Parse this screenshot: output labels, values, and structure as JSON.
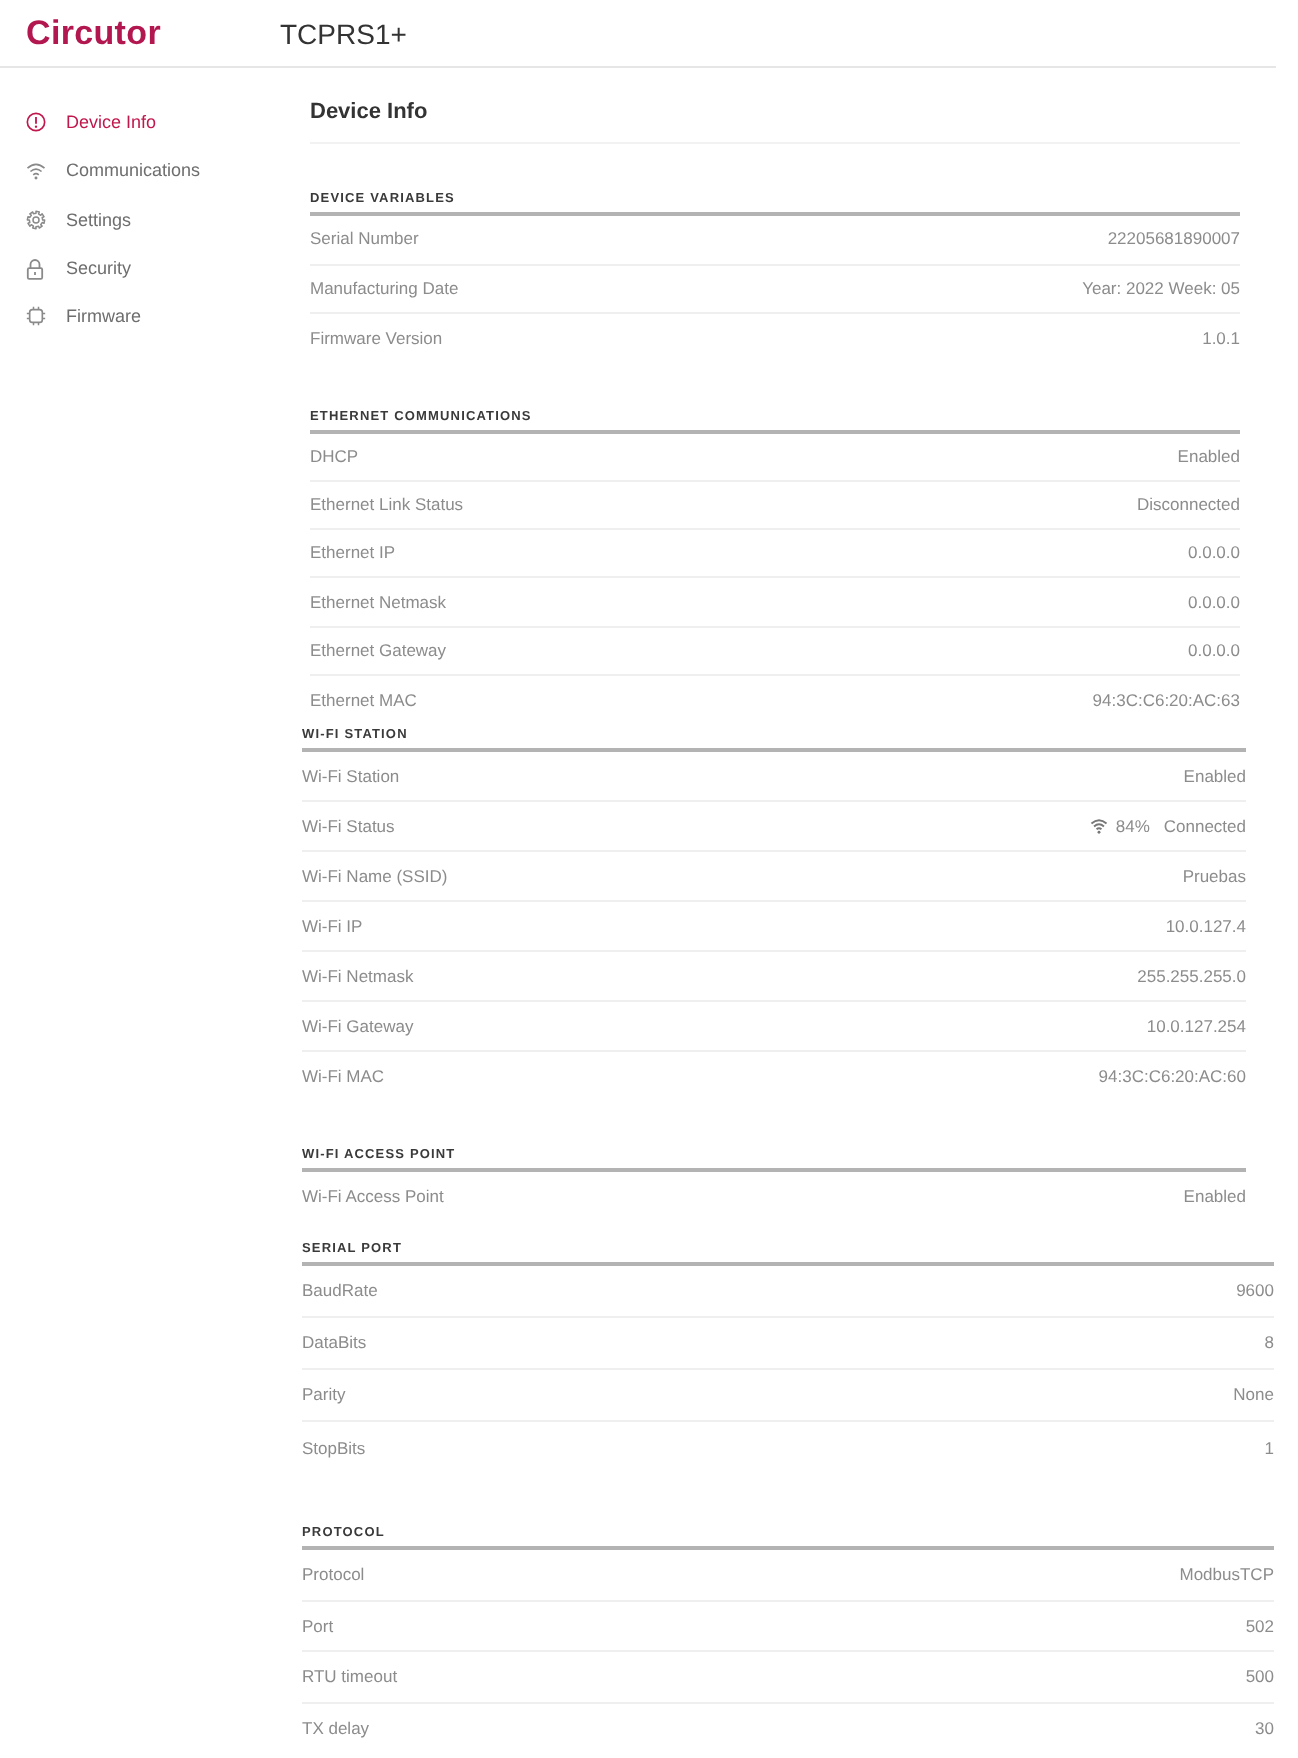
{
  "header": {
    "logo": "Circutor",
    "device": "TCPRS1+"
  },
  "sidebar": {
    "items": [
      {
        "label": "Device Info",
        "selected": true
      },
      {
        "label": "Communications",
        "selected": false
      },
      {
        "label": "Settings",
        "selected": false
      },
      {
        "label": "Security",
        "selected": false
      },
      {
        "label": "Firmware",
        "selected": false
      }
    ]
  },
  "page": {
    "title": "Device Info"
  },
  "sections": [
    {
      "title": "DEVICE VARIABLES",
      "rows": [
        {
          "kind": "text",
          "label": "Serial Number",
          "value": "22205681890007"
        },
        {
          "kind": "text",
          "label": "Manufacturing Date",
          "value": "Year: 2022 Week: 05"
        },
        {
          "kind": "text",
          "label": "Firmware Version",
          "value": "1.0.1"
        }
      ]
    },
    {
      "title": "ETHERNET COMMUNICATIONS",
      "rows": [
        {
          "kind": "text",
          "label": "DHCP",
          "value": "Enabled"
        },
        {
          "kind": "text",
          "label": "Ethernet Link Status",
          "value": "Disconnected"
        },
        {
          "kind": "text",
          "label": "Ethernet IP",
          "value": "0.0.0.0"
        },
        {
          "kind": "text",
          "label": "Ethernet Netmask",
          "value": "0.0.0.0"
        },
        {
          "kind": "text",
          "label": "Ethernet Gateway",
          "value": "0.0.0.0"
        },
        {
          "kind": "text",
          "label": "Ethernet MAC",
          "value": "94:3C:C6:20:AC:63"
        }
      ]
    },
    {
      "title": "WI-FI STATION",
      "rows": [
        {
          "kind": "text",
          "label": "Wi-Fi Station",
          "value": "Enabled"
        },
        {
          "kind": "wifi",
          "label": "Wi-Fi Status",
          "signal": "84%",
          "value": "Connected"
        },
        {
          "kind": "text",
          "label": "Wi-Fi Name (SSID)",
          "value": "Pruebas"
        },
        {
          "kind": "text",
          "label": "Wi-Fi IP",
          "value": "10.0.127.4"
        },
        {
          "kind": "text",
          "label": "Wi-Fi Netmask",
          "value": "255.255.255.0"
        },
        {
          "kind": "text",
          "label": "Wi-Fi Gateway",
          "value": "10.0.127.254"
        },
        {
          "kind": "text",
          "label": "Wi-Fi MAC",
          "value": "94:3C:C6:20:AC:60"
        }
      ]
    },
    {
      "title": "WI-FI ACCESS POINT",
      "rows": [
        {
          "kind": "text",
          "label": "Wi-Fi Access Point",
          "value": "Enabled"
        }
      ]
    },
    {
      "title": "SERIAL PORT",
      "rows": [
        {
          "kind": "text",
          "label": "BaudRate",
          "value": "9600"
        },
        {
          "kind": "text",
          "label": "DataBits",
          "value": "8"
        },
        {
          "kind": "text",
          "label": "Parity",
          "value": "None"
        },
        {
          "kind": "text",
          "label": "StopBits",
          "value": "1"
        }
      ]
    },
    {
      "title": "PROTOCOL",
      "rows": [
        {
          "kind": "text",
          "label": "Protocol",
          "value": "ModbusTCP"
        },
        {
          "kind": "text",
          "label": "Port",
          "value": "502"
        },
        {
          "kind": "text",
          "label": "RTU timeout",
          "value": "500"
        },
        {
          "kind": "text",
          "label": "TX delay",
          "value": "30"
        }
      ]
    }
  ]
}
